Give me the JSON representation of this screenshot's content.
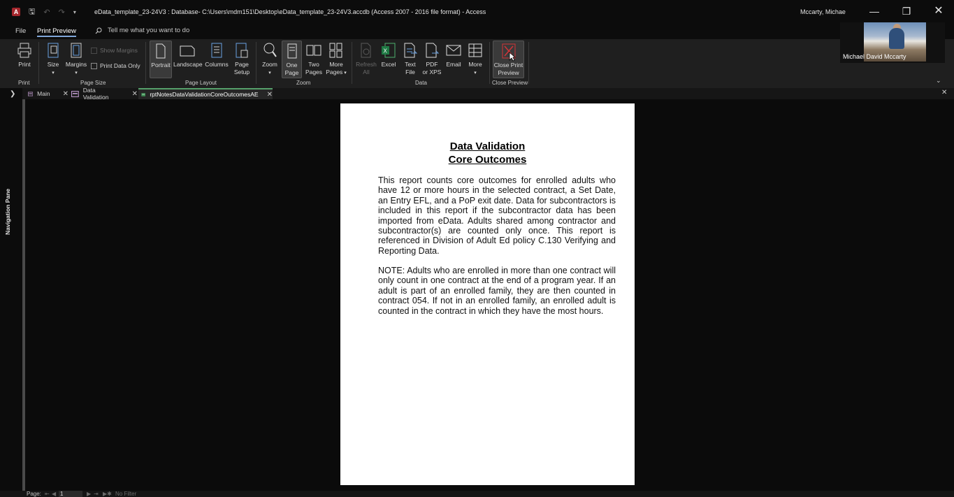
{
  "titlebar": {
    "app_letter": "A",
    "title": "eData_template_23-24V3 : Database- C:\\Users\\mdm151\\Desktop\\eData_template_23-24V3.accdb (Access 2007 - 2016 file format)  -  Access",
    "user": "Mccarty, Michae"
  },
  "tabs": {
    "file": "File",
    "print_preview": "Print Preview",
    "tell_me": "Tell me what you want to do"
  },
  "ribbon": {
    "print": "Print",
    "size": "Size",
    "margins": "Margins",
    "show_margins": "Show Margins",
    "print_data_only": "Print Data Only",
    "portrait": "Portrait",
    "landscape": "Landscape",
    "columns": "Columns",
    "page_setup_1": "Page",
    "page_setup_2": "Setup",
    "zoom": "Zoom",
    "one_page_1": "One",
    "one_page_2": "Page",
    "two_pages_1": "Two",
    "two_pages_2": "Pages",
    "more_pages_1": "More",
    "more_pages_2": "Pages",
    "refresh_all_1": "Refresh",
    "refresh_all_2": "All",
    "excel": "Excel",
    "text_file_1": "Text",
    "text_file_2": "File",
    "pdf_1": "PDF",
    "pdf_2": "or XPS",
    "email": "Email",
    "more": "More",
    "close_1": "Close Print",
    "close_2": "Preview",
    "groups": {
      "print": "Print",
      "page_size": "Page Size",
      "page_layout": "Page Layout",
      "zoom": "Zoom",
      "data": "Data",
      "close_preview": "Close Preview"
    }
  },
  "participant": {
    "name": "Michael David Mccarty"
  },
  "doc_tabs": [
    {
      "label": "Main"
    },
    {
      "label": "Data Validation"
    },
    {
      "label": "rptNotesDataValidationCoreOutcomesAE"
    }
  ],
  "nav_pane": {
    "label": "Navigation Pane"
  },
  "report": {
    "title_line1": "Data Validation",
    "title_line2": "Core Outcomes",
    "para1": "This report counts core outcomes for enrolled adults who have 12 or more hours in the selected contract, a Set Date, an Entry EFL, and a PoP exit date. Data for subcontractors is included in this report if the subcontractor data has been imported from eData. Adults shared among contractor and subcontractor(s) are counted only once. This report is referenced in Division of Adult Ed policy C.130 Verifying and Reporting Data.",
    "para2": "NOTE: Adults who are enrolled in more than one contract will only count in one contract at the end of a program year. If an adult is part of an enrolled family, they are then counted in contract 054. If not in an enrolled family, an enrolled adult is counted in the contract in which they have the most hours."
  },
  "status": {
    "page_label": "Page:",
    "page_value": "1",
    "filter": "No Filter"
  },
  "colors": {
    "accent_tab": "#7fa5d8",
    "active_doc_tab": "#56a06a",
    "close_icon": "#d13438"
  }
}
